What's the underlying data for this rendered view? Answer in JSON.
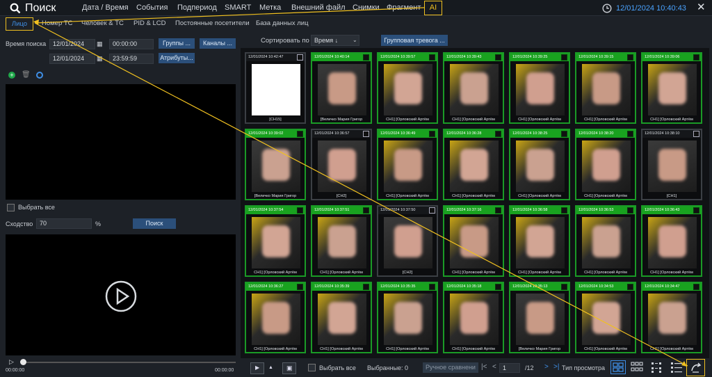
{
  "header": {
    "title": "Поиск",
    "nav": [
      "Дата / Время",
      "События",
      "Подпериод",
      "SMART",
      "Метка",
      "Внешний файл",
      "Снимки",
      "Фрагмент",
      "AI"
    ],
    "datetime": "12/01/2024 10:40:43"
  },
  "subtabs": [
    "Лицо",
    "Номер ТС",
    "Человек & ТС",
    "PID & LCD",
    "Постоянные посетители",
    "База данных лиц"
  ],
  "search": {
    "time_label": "Время поиска",
    "date_start": "12/01/2024",
    "time_start": "00:00:00",
    "date_end": "12/01/2024",
    "time_end": "23:59:59",
    "groups_btn": "Группы ...",
    "channels_btn": "Каналы ...",
    "attrs_btn": "Атрибуты..."
  },
  "select_all_left": "Выбрать все",
  "similarity": {
    "label": "Сходство",
    "value": "70",
    "unit": "%",
    "search_btn": "Поиск"
  },
  "player": {
    "start": "00:00:00",
    "end": "00:00:00"
  },
  "sort": {
    "label": "Сортировать по",
    "value": "Время ↓",
    "group_alarm": "Групповая тревога ..."
  },
  "cards": [
    {
      "ts": "12/01/2024 10:42:47",
      "cap": "[CH15]",
      "green": false
    },
    {
      "ts": "12/01/2024 10:40:14",
      "cap": "[Величко Мария Григор",
      "green": true
    },
    {
      "ts": "12/01/2024 10:39:57",
      "cap": "CH1] [Орловский Артём",
      "green": true
    },
    {
      "ts": "12/01/2024 10:39:43",
      "cap": "CH1] [Орловский Артём",
      "green": true
    },
    {
      "ts": "12/01/2024 10:39:25",
      "cap": "CH1] [Орловский Артём",
      "green": true
    },
    {
      "ts": "12/01/2024 10:39:15",
      "cap": "CH1] [Орловский Артём",
      "green": true
    },
    {
      "ts": "12/01/2024 10:39:06",
      "cap": "CH1] [Орловский Артём",
      "green": true
    },
    {
      "ts": "12/01/2024 10:39:02",
      "cap": "[Величко Мария Григор",
      "green": true
    },
    {
      "ts": "12/01/2024 10:36:57",
      "cap": "[CH2]",
      "green": false
    },
    {
      "ts": "12/01/2024 10:36:49",
      "cap": "CH1] [Орловский Артём",
      "green": true
    },
    {
      "ts": "12/01/2024 10:36:28",
      "cap": "CH1] [Орловский Артём",
      "green": true
    },
    {
      "ts": "12/01/2024 10:38:25",
      "cap": "CH1] [Орловский Артём",
      "green": true
    },
    {
      "ts": "12/01/2024 10:38:20",
      "cap": "CH1] [Орловский Артём",
      "green": true
    },
    {
      "ts": "12/01/2024 10:38:10",
      "cap": "[CH1]",
      "green": false
    },
    {
      "ts": "12/01/2024 10:37:54",
      "cap": "CH1] [Орловский Артём",
      "green": true
    },
    {
      "ts": "12/01/2024 10:37:51",
      "cap": "CH1] [Орловский Артём",
      "green": true
    },
    {
      "ts": "12/01/2024 10:37:50",
      "cap": "[CH2]",
      "green": false
    },
    {
      "ts": "12/01/2024 10:37:16",
      "cap": "CH1] [Орловский Артём",
      "green": true
    },
    {
      "ts": "12/01/2024 10:36:58",
      "cap": "CH1] [Орловский Артём",
      "green": true
    },
    {
      "ts": "12/01/2024 10:36:53",
      "cap": "CH1] [Орловский Артём",
      "green": true
    },
    {
      "ts": "12/01/2024 10:36:43",
      "cap": "CH1] [Орловский Артём",
      "green": true
    },
    {
      "ts": "12/01/2024 10:36:27",
      "cap": "CH1] [Орловский Артём",
      "green": true
    },
    {
      "ts": "12/01/2024 10:35:39",
      "cap": "CH1] [Орловский Артём",
      "green": true
    },
    {
      "ts": "12/01/2024 10:35:35",
      "cap": "CH1] [Орловский Артём",
      "green": true
    },
    {
      "ts": "12/01/2024 10:35:18",
      "cap": "CH1] [Орловский Артём",
      "green": true
    },
    {
      "ts": "12/01/2024 10:35:13",
      "cap": "[Величко Мария Григор",
      "green": true
    },
    {
      "ts": "12/01/2024 10:34:53",
      "cap": "CH1] [Орловский Артём",
      "green": true
    },
    {
      "ts": "12/01/2024 10:34:47",
      "cap": "CH1] [Орловский Артём",
      "green": true
    }
  ],
  "footer": {
    "select_all": "Выбрать все",
    "selected": "Выбранные: 0",
    "compare": "Ручное сравнени",
    "page": "1",
    "total": "/12",
    "view_type": "Тип просмотра"
  },
  "colors": {
    "accent": "#3f8fe6",
    "green": "#19a21f",
    "annotation": "#f0c020"
  }
}
